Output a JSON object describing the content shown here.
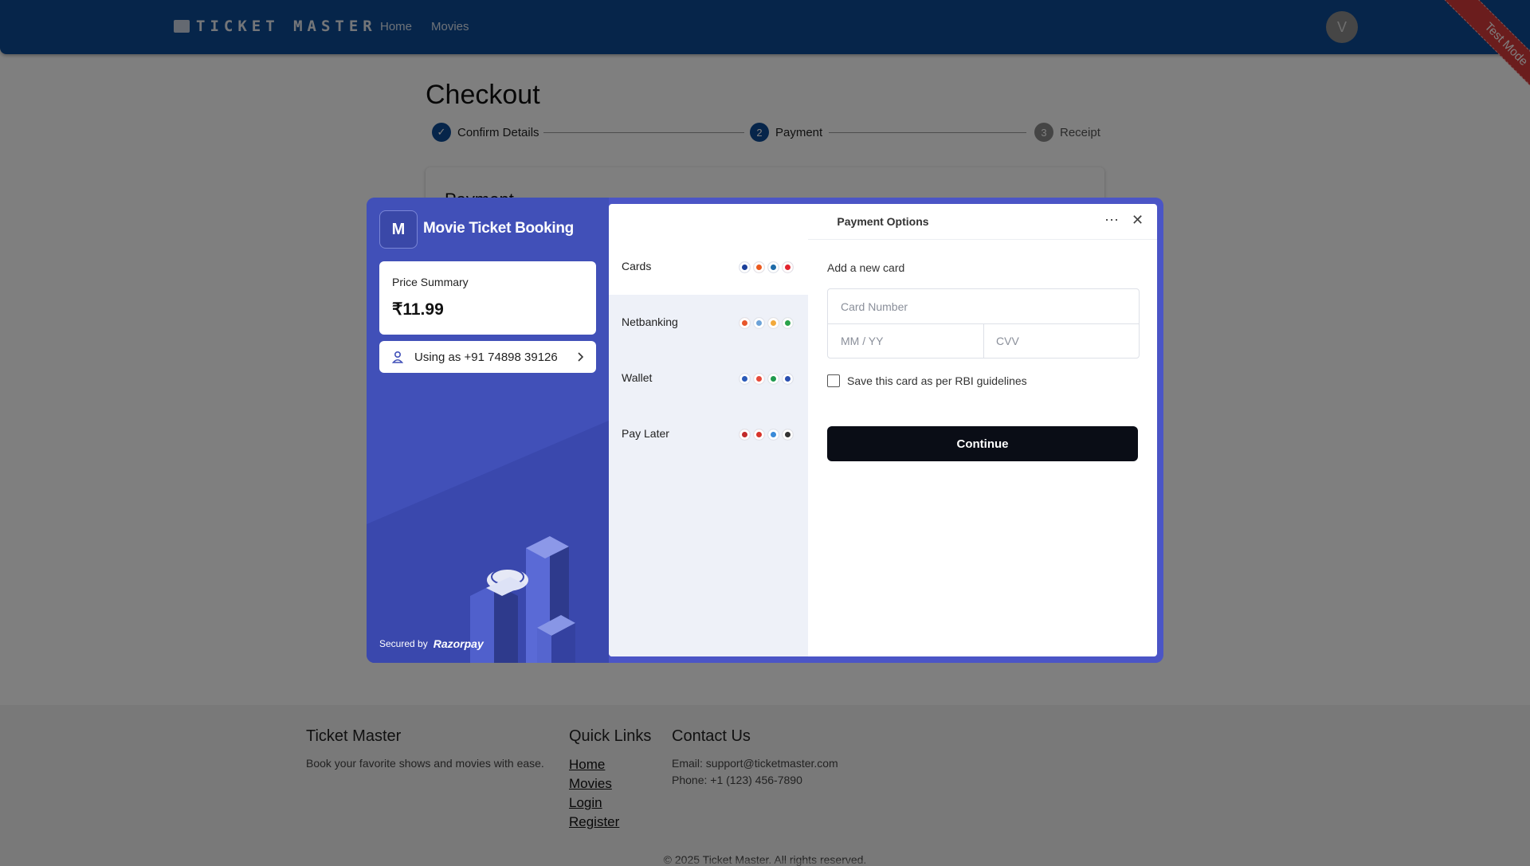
{
  "header": {
    "logo_text": "TICKET MASTER",
    "nav": [
      "Home",
      "Movies"
    ],
    "avatar_initial": "V",
    "test_mode": "Test Mode"
  },
  "checkout": {
    "title": "Checkout",
    "steps": [
      {
        "label": "Confirm Details",
        "badge": "✓",
        "state": "done"
      },
      {
        "label": "Payment",
        "badge": "2",
        "state": "active"
      },
      {
        "label": "Receipt",
        "badge": "3",
        "state": "pending"
      }
    ],
    "card_title": "Payment"
  },
  "modal": {
    "brand_initial": "M",
    "brand_name": "Movie Ticket Booking",
    "price_label": "Price Summary",
    "price": "₹11.99",
    "user_text": "Using as +91 74898 39126",
    "secured_by": "Secured by",
    "provider": "Razorpay",
    "title": "Payment Options",
    "methods": [
      {
        "label": "Cards",
        "icons": [
          "#1a3f9a",
          "#eb5a1f",
          "#1d6aa8",
          "#e2232e"
        ]
      },
      {
        "label": "Netbanking",
        "icons": [
          "#e8562a",
          "#6da3d8",
          "#f2a93b",
          "#2aa34a"
        ]
      },
      {
        "label": "Wallet",
        "icons": [
          "#2a5ab8",
          "#e64a3a",
          "#1f9a4d",
          "#2a4fb0"
        ]
      },
      {
        "label": "Pay Later",
        "icons": [
          "#c22a2a",
          "#d8342b",
          "#3a8ad8",
          "#333333"
        ]
      }
    ],
    "form": {
      "heading": "Add a new card",
      "card_number": "Card Number",
      "expiry": "MM / YY",
      "cvv": "CVV",
      "save_label": "Save this card as per RBI guidelines",
      "continue": "Continue"
    }
  },
  "footer": {
    "brand_title": "Ticket Master",
    "brand_desc": "Book your favorite shows and movies with ease.",
    "quick_title": "Quick Links",
    "links": [
      "Home",
      "Movies",
      "Login",
      "Register"
    ],
    "contact_title": "Contact Us",
    "email": "Email: support@ticketmaster.com",
    "phone": "Phone: +1 (123) 456-7890",
    "copyright": "© 2025 Ticket Master. All rights reserved."
  },
  "colors": {
    "header": "#0d4a94",
    "modal_bg": "#4150b8",
    "continue_btn": "#0a0d16",
    "test_ribbon": "#d63a3a"
  }
}
